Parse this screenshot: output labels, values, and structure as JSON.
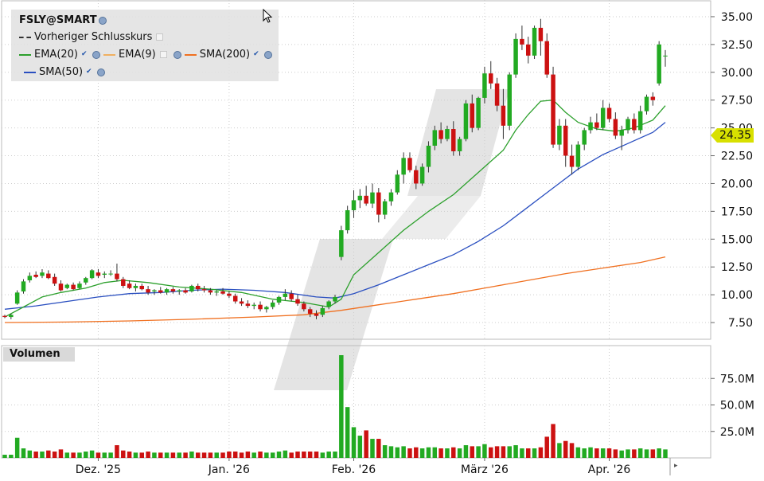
{
  "chart_data": {
    "type": "candlestick",
    "instrument": "FSLY@SMART",
    "legend": {
      "title": "FSLY@SMART",
      "previous_close_label": "Vorheriger Schlusskurs",
      "items": [
        {
          "name": "EMA(20)",
          "color": "#2ca02c"
        },
        {
          "name": "EMA(9)",
          "color": "#f0b060"
        },
        {
          "name": "SMA(200)",
          "color": "#f07020"
        },
        {
          "name": "SMA(50)",
          "color": "#2a4fc0"
        }
      ]
    },
    "current_price_label": "24.35",
    "colors": {
      "up": "#22aa22",
      "down": "#cc1111",
      "grid": "#cccccc"
    },
    "y_ticks": [
      "35.00",
      "32.50",
      "30.00",
      "27.50",
      "25.00",
      "22.50",
      "20.00",
      "17.50",
      "15.00",
      "12.50",
      "10.00",
      "7.50"
    ],
    "ylim": [
      6.0,
      36.5
    ],
    "volume": {
      "title": "Volumen",
      "ticks": [
        "75.0M",
        "50.0M",
        "25.0M"
      ],
      "ylim": [
        0,
        100
      ]
    },
    "x_labels": [
      "Dez. '25",
      "Jan. '26",
      "Feb. '26",
      "März '26",
      "Apr. '26"
    ],
    "x_label_index": [
      15,
      36,
      56,
      77,
      97
    ],
    "candles": [
      [
        8.1,
        8.2,
        7.9,
        8.0
      ],
      [
        8.0,
        8.3,
        7.8,
        8.2
      ],
      [
        9.2,
        10.4,
        9.1,
        10.2
      ],
      [
        10.3,
        11.4,
        10.1,
        11.2
      ],
      [
        11.3,
        12.0,
        11.1,
        11.7
      ],
      [
        11.8,
        12.1,
        11.5,
        11.6
      ],
      [
        11.7,
        12.3,
        11.5,
        12.0
      ],
      [
        11.9,
        12.2,
        11.4,
        11.5
      ],
      [
        11.6,
        11.9,
        10.8,
        11.0
      ],
      [
        11.0,
        11.3,
        10.3,
        10.4
      ],
      [
        10.6,
        11.0,
        10.5,
        10.9
      ],
      [
        10.9,
        11.1,
        10.4,
        10.5
      ],
      [
        10.6,
        11.2,
        10.5,
        11.0
      ],
      [
        11.1,
        11.6,
        10.9,
        11.5
      ],
      [
        11.5,
        12.3,
        11.4,
        12.2
      ],
      [
        12.0,
        12.3,
        11.5,
        11.7
      ],
      [
        11.8,
        12.1,
        11.5,
        11.9
      ],
      [
        11.9,
        12.2,
        11.7,
        11.9
      ],
      [
        11.9,
        12.8,
        11.2,
        11.4
      ],
      [
        11.4,
        11.6,
        10.6,
        10.8
      ],
      [
        11.0,
        11.3,
        10.5,
        10.6
      ],
      [
        10.6,
        11.0,
        10.3,
        10.8
      ],
      [
        10.8,
        11.0,
        10.4,
        10.5
      ],
      [
        10.5,
        10.8,
        10.0,
        10.2
      ],
      [
        10.3,
        10.5,
        10.0,
        10.4
      ],
      [
        10.4,
        10.7,
        10.1,
        10.2
      ],
      [
        10.2,
        10.6,
        10.0,
        10.5
      ],
      [
        10.5,
        10.7,
        10.1,
        10.3
      ],
      [
        10.3,
        10.5,
        10.0,
        10.4
      ],
      [
        10.4,
        10.6,
        10.1,
        10.2
      ],
      [
        10.3,
        10.9,
        10.2,
        10.8
      ],
      [
        10.8,
        11.0,
        10.3,
        10.5
      ],
      [
        10.5,
        10.8,
        10.2,
        10.4
      ],
      [
        10.4,
        10.6,
        10.0,
        10.2
      ],
      [
        10.2,
        10.4,
        9.9,
        10.3
      ],
      [
        10.3,
        10.6,
        10.0,
        10.1
      ],
      [
        10.1,
        10.3,
        9.7,
        9.9
      ],
      [
        9.9,
        10.1,
        9.2,
        9.4
      ],
      [
        9.4,
        9.7,
        9.0,
        9.2
      ],
      [
        9.2,
        9.5,
        8.8,
        9.0
      ],
      [
        9.0,
        9.3,
        8.7,
        9.1
      ],
      [
        9.1,
        9.4,
        8.5,
        8.7
      ],
      [
        8.7,
        9.0,
        8.4,
        8.9
      ],
      [
        8.9,
        9.5,
        8.7,
        9.3
      ],
      [
        9.3,
        9.9,
        9.1,
        9.8
      ],
      [
        9.8,
        10.5,
        9.5,
        10.1
      ],
      [
        10.1,
        10.4,
        9.4,
        9.6
      ],
      [
        9.6,
        10.0,
        9.0,
        9.2
      ],
      [
        9.2,
        9.4,
        8.5,
        8.7
      ],
      [
        8.7,
        8.9,
        8.0,
        8.3
      ],
      [
        8.3,
        8.6,
        7.8,
        8.1
      ],
      [
        8.2,
        9.0,
        8.0,
        8.8
      ],
      [
        8.9,
        9.5,
        8.7,
        9.4
      ],
      [
        9.4,
        10.0,
        9.2,
        9.8
      ],
      [
        13.4,
        16.2,
        13.1,
        15.8
      ],
      [
        15.8,
        18.0,
        15.5,
        17.6
      ],
      [
        17.6,
        19.4,
        16.9,
        18.5
      ],
      [
        18.5,
        19.5,
        17.8,
        18.9
      ],
      [
        18.9,
        19.8,
        18.0,
        18.2
      ],
      [
        18.2,
        20.0,
        17.8,
        19.2
      ],
      [
        19.2,
        19.6,
        16.5,
        17.2
      ],
      [
        17.2,
        18.6,
        16.8,
        18.4
      ],
      [
        18.4,
        19.5,
        18.0,
        19.2
      ],
      [
        19.2,
        21.2,
        19.0,
        20.8
      ],
      [
        20.8,
        22.8,
        20.0,
        22.3
      ],
      [
        22.3,
        22.8,
        21.0,
        21.2
      ],
      [
        21.2,
        21.6,
        19.5,
        20.0
      ],
      [
        20.0,
        21.8,
        19.8,
        21.5
      ],
      [
        21.5,
        23.8,
        21.0,
        23.4
      ],
      [
        23.4,
        25.2,
        23.0,
        24.8
      ],
      [
        24.8,
        25.5,
        23.6,
        24.0
      ],
      [
        24.0,
        25.2,
        23.8,
        24.9
      ],
      [
        24.9,
        25.6,
        22.5,
        22.9
      ],
      [
        22.9,
        24.2,
        22.5,
        24.0
      ],
      [
        24.0,
        27.5,
        23.8,
        27.2
      ],
      [
        27.2,
        28.0,
        24.6,
        25.0
      ],
      [
        25.0,
        27.8,
        24.8,
        27.7
      ],
      [
        27.7,
        30.5,
        27.2,
        29.9
      ],
      [
        29.9,
        31.0,
        28.5,
        29.0
      ],
      [
        29.0,
        29.5,
        26.5,
        27.0
      ],
      [
        27.0,
        28.5,
        24.0,
        25.2
      ],
      [
        25.2,
        30.0,
        24.8,
        29.8
      ],
      [
        29.8,
        33.5,
        29.5,
        33.0
      ],
      [
        33.0,
        34.2,
        32.0,
        32.5
      ],
      [
        32.5,
        33.2,
        30.8,
        31.5
      ],
      [
        31.5,
        34.2,
        31.2,
        34.0
      ],
      [
        34.0,
        34.8,
        31.5,
        32.8
      ],
      [
        32.8,
        33.5,
        29.5,
        29.8
      ],
      [
        29.8,
        30.5,
        23.2,
        23.5
      ],
      [
        23.5,
        25.8,
        23.0,
        25.2
      ],
      [
        25.2,
        25.8,
        21.5,
        22.5
      ],
      [
        22.5,
        23.5,
        20.8,
        21.5
      ],
      [
        21.5,
        23.8,
        21.2,
        23.5
      ],
      [
        23.5,
        25.0,
        23.0,
        24.8
      ],
      [
        24.8,
        26.0,
        24.5,
        25.5
      ],
      [
        25.5,
        26.3,
        24.8,
        25.0
      ],
      [
        25.0,
        27.5,
        24.8,
        26.8
      ],
      [
        26.8,
        27.2,
        25.5,
        25.8
      ],
      [
        25.8,
        26.4,
        24.0,
        24.3
      ],
      [
        24.3,
        25.2,
        23.0,
        24.8
      ],
      [
        24.8,
        26.0,
        24.5,
        25.8
      ],
      [
        25.8,
        26.3,
        24.5,
        24.8
      ],
      [
        24.8,
        27.0,
        24.5,
        26.5
      ],
      [
        26.5,
        28.0,
        26.2,
        27.8
      ],
      [
        27.8,
        28.2,
        27.0,
        27.5
      ],
      [
        29.0,
        32.8,
        28.8,
        32.5
      ],
      [
        31.5,
        32.0,
        30.5,
        31.5
      ]
    ],
    "volumes": [
      [
        3,
        1
      ],
      [
        3,
        1
      ],
      [
        19,
        1
      ],
      [
        9,
        1
      ],
      [
        7,
        1
      ],
      [
        6,
        0
      ],
      [
        6,
        1
      ],
      [
        7,
        0
      ],
      [
        6,
        0
      ],
      [
        8,
        0
      ],
      [
        5,
        1
      ],
      [
        5,
        0
      ],
      [
        5,
        1
      ],
      [
        6,
        1
      ],
      [
        7,
        1
      ],
      [
        5,
        0
      ],
      [
        5,
        1
      ],
      [
        5,
        1
      ],
      [
        12,
        0
      ],
      [
        7,
        0
      ],
      [
        6,
        0
      ],
      [
        5,
        1
      ],
      [
        5,
        0
      ],
      [
        6,
        0
      ],
      [
        5,
        1
      ],
      [
        5,
        0
      ],
      [
        5,
        1
      ],
      [
        5,
        0
      ],
      [
        5,
        1
      ],
      [
        5,
        0
      ],
      [
        6,
        1
      ],
      [
        5,
        0
      ],
      [
        5,
        0
      ],
      [
        5,
        0
      ],
      [
        5,
        1
      ],
      [
        5,
        0
      ],
      [
        6,
        0
      ],
      [
        6,
        0
      ],
      [
        5,
        0
      ],
      [
        6,
        0
      ],
      [
        5,
        1
      ],
      [
        6,
        0
      ],
      [
        5,
        1
      ],
      [
        5,
        1
      ],
      [
        6,
        1
      ],
      [
        7,
        1
      ],
      [
        5,
        0
      ],
      [
        6,
        0
      ],
      [
        6,
        0
      ],
      [
        6,
        0
      ],
      [
        6,
        0
      ],
      [
        5,
        1
      ],
      [
        6,
        1
      ],
      [
        6,
        1
      ],
      [
        97,
        1
      ],
      [
        48,
        1
      ],
      [
        29,
        1
      ],
      [
        21,
        1
      ],
      [
        26,
        0
      ],
      [
        18,
        1
      ],
      [
        18,
        0
      ],
      [
        12,
        1
      ],
      [
        11,
        1
      ],
      [
        10,
        1
      ],
      [
        11,
        1
      ],
      [
        9,
        0
      ],
      [
        10,
        0
      ],
      [
        9,
        1
      ],
      [
        10,
        1
      ],
      [
        10,
        1
      ],
      [
        9,
        0
      ],
      [
        9,
        1
      ],
      [
        10,
        0
      ],
      [
        9,
        1
      ],
      [
        12,
        1
      ],
      [
        11,
        0
      ],
      [
        11,
        1
      ],
      [
        13,
        1
      ],
      [
        10,
        0
      ],
      [
        11,
        0
      ],
      [
        11,
        0
      ],
      [
        11,
        1
      ],
      [
        12,
        1
      ],
      [
        9,
        1
      ],
      [
        9,
        0
      ],
      [
        9,
        1
      ],
      [
        10,
        0
      ],
      [
        20,
        0
      ],
      [
        32,
        0
      ],
      [
        14,
        1
      ],
      [
        16,
        0
      ],
      [
        14,
        0
      ],
      [
        10,
        1
      ],
      [
        9,
        1
      ],
      [
        10,
        1
      ],
      [
        9,
        0
      ],
      [
        9,
        1
      ],
      [
        9,
        0
      ],
      [
        8,
        0
      ],
      [
        7,
        1
      ],
      [
        8,
        1
      ],
      [
        8,
        0
      ],
      [
        9,
        1
      ],
      [
        8,
        1
      ],
      [
        8,
        0
      ],
      [
        9,
        1
      ],
      [
        8,
        1
      ]
    ],
    "ema20": [
      [
        0,
        8.0
      ],
      [
        3,
        8.9
      ],
      [
        6,
        9.8
      ],
      [
        9,
        10.2
      ],
      [
        13,
        10.6
      ],
      [
        16,
        11.1
      ],
      [
        19,
        11.3
      ],
      [
        23,
        11.1
      ],
      [
        28,
        10.7
      ],
      [
        33,
        10.5
      ],
      [
        38,
        10.2
      ],
      [
        43,
        9.6
      ],
      [
        48,
        9.3
      ],
      [
        52,
        8.9
      ],
      [
        54,
        9.6
      ],
      [
        56,
        11.8
      ],
      [
        60,
        13.8
      ],
      [
        64,
        15.8
      ],
      [
        68,
        17.5
      ],
      [
        72,
        19.0
      ],
      [
        76,
        21.0
      ],
      [
        80,
        23.0
      ],
      [
        82,
        24.8
      ],
      [
        84,
        26.2
      ],
      [
        86,
        27.4
      ],
      [
        88,
        27.5
      ],
      [
        90,
        26.4
      ],
      [
        92,
        25.5
      ],
      [
        95,
        24.9
      ],
      [
        98,
        24.7
      ],
      [
        101,
        25.0
      ],
      [
        104,
        25.7
      ],
      [
        106,
        27.0
      ]
    ],
    "sma50": [
      [
        0,
        8.7
      ],
      [
        5,
        9.0
      ],
      [
        10,
        9.4
      ],
      [
        15,
        9.8
      ],
      [
        20,
        10.1
      ],
      [
        25,
        10.2
      ],
      [
        30,
        10.4
      ],
      [
        35,
        10.5
      ],
      [
        40,
        10.4
      ],
      [
        45,
        10.2
      ],
      [
        50,
        9.8
      ],
      [
        53,
        9.7
      ],
      [
        56,
        10.1
      ],
      [
        60,
        10.9
      ],
      [
        64,
        11.8
      ],
      [
        68,
        12.7
      ],
      [
        72,
        13.6
      ],
      [
        76,
        14.8
      ],
      [
        80,
        16.2
      ],
      [
        84,
        17.9
      ],
      [
        88,
        19.6
      ],
      [
        92,
        21.3
      ],
      [
        96,
        22.6
      ],
      [
        100,
        23.6
      ],
      [
        104,
        24.6
      ],
      [
        106,
        25.5
      ]
    ],
    "sma200": [
      [
        0,
        7.5
      ],
      [
        10,
        7.55
      ],
      [
        20,
        7.65
      ],
      [
        30,
        7.8
      ],
      [
        40,
        8.0
      ],
      [
        48,
        8.2
      ],
      [
        54,
        8.6
      ],
      [
        60,
        9.1
      ],
      [
        66,
        9.6
      ],
      [
        72,
        10.1
      ],
      [
        78,
        10.7
      ],
      [
        84,
        11.3
      ],
      [
        90,
        11.9
      ],
      [
        96,
        12.4
      ],
      [
        102,
        12.9
      ],
      [
        106,
        13.4
      ]
    ]
  }
}
